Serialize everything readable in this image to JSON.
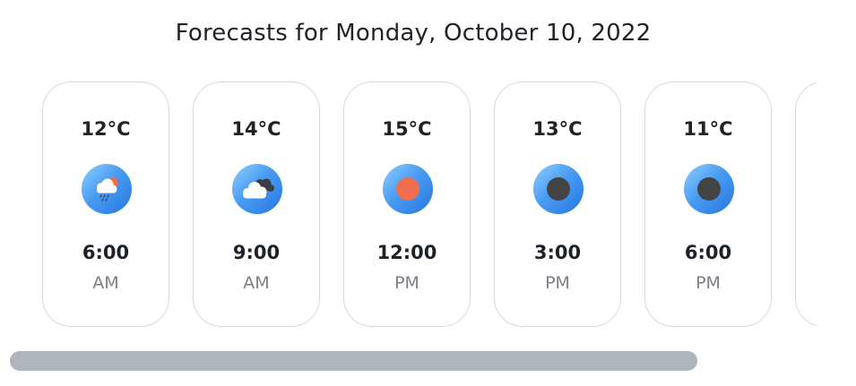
{
  "header": {
    "title": "Forecasts for Monday, October 10, 2022"
  },
  "forecasts": [
    {
      "temp": "12°C",
      "time": "6:00",
      "period": "AM",
      "icon": "rain-cloud-sun-icon"
    },
    {
      "temp": "14°C",
      "time": "9:00",
      "period": "AM",
      "icon": "cloudy-icon"
    },
    {
      "temp": "15°C",
      "time": "12:00",
      "period": "PM",
      "icon": "sun-icon"
    },
    {
      "temp": "13°C",
      "time": "3:00",
      "period": "PM",
      "icon": "moon-icon"
    },
    {
      "temp": "11°C",
      "time": "6:00",
      "period": "PM",
      "icon": "moon-icon"
    }
  ],
  "scroll": {
    "thumb_fraction": 0.85,
    "position_fraction": 0.0
  },
  "colors": {
    "sun": "#ee6e4d",
    "moon": "#444444",
    "icon_gradient_light": "#8fd0ff",
    "icon_gradient_dark": "#2478e0",
    "scroll_thumb": "#adb5bd",
    "card_border": "#d9d9d9"
  }
}
